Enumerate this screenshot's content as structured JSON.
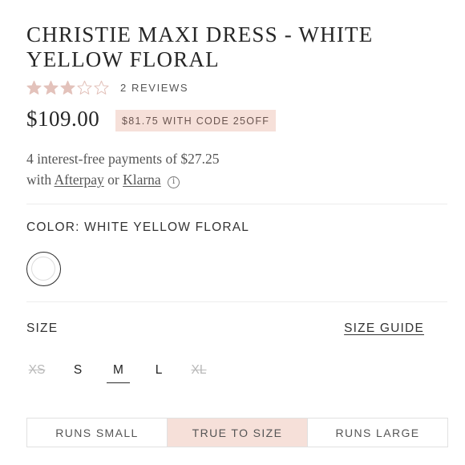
{
  "product": {
    "title_line1": "CHRISTIE MAXI DRESS - WHITE",
    "title_line2": "YELLOW FLORAL",
    "rating": 3,
    "rating_max": 5,
    "reviews_label": "2 REVIEWS",
    "price": "$109.00",
    "promo": "$81.75 WITH CODE 25OFF"
  },
  "payment": {
    "line1": "4 interest-free payments of $27.25",
    "with": "with",
    "afterpay": "Afterpay",
    "or": "or",
    "klarna": "Klarna",
    "info_glyph": "i"
  },
  "color": {
    "label": "COLOR: WHITE YELLOW FLORAL",
    "swatch_color": "#ffffff"
  },
  "size": {
    "label": "SIZE",
    "guide_label": "SIZE GUIDE",
    "options": [
      {
        "label": "XS",
        "available": false,
        "selected": false
      },
      {
        "label": "S",
        "available": true,
        "selected": false
      },
      {
        "label": "M",
        "available": true,
        "selected": true
      },
      {
        "label": "L",
        "available": true,
        "selected": false
      },
      {
        "label": "XL",
        "available": false,
        "selected": false
      }
    ]
  },
  "fit": {
    "options": [
      "RUNS SMALL",
      "TRUE TO SIZE",
      "RUNS LARGE"
    ],
    "active_index": 1
  },
  "colors": {
    "accent": "#f6e0d9",
    "star": "#e3c2bb",
    "text": "#2b2b2b"
  }
}
